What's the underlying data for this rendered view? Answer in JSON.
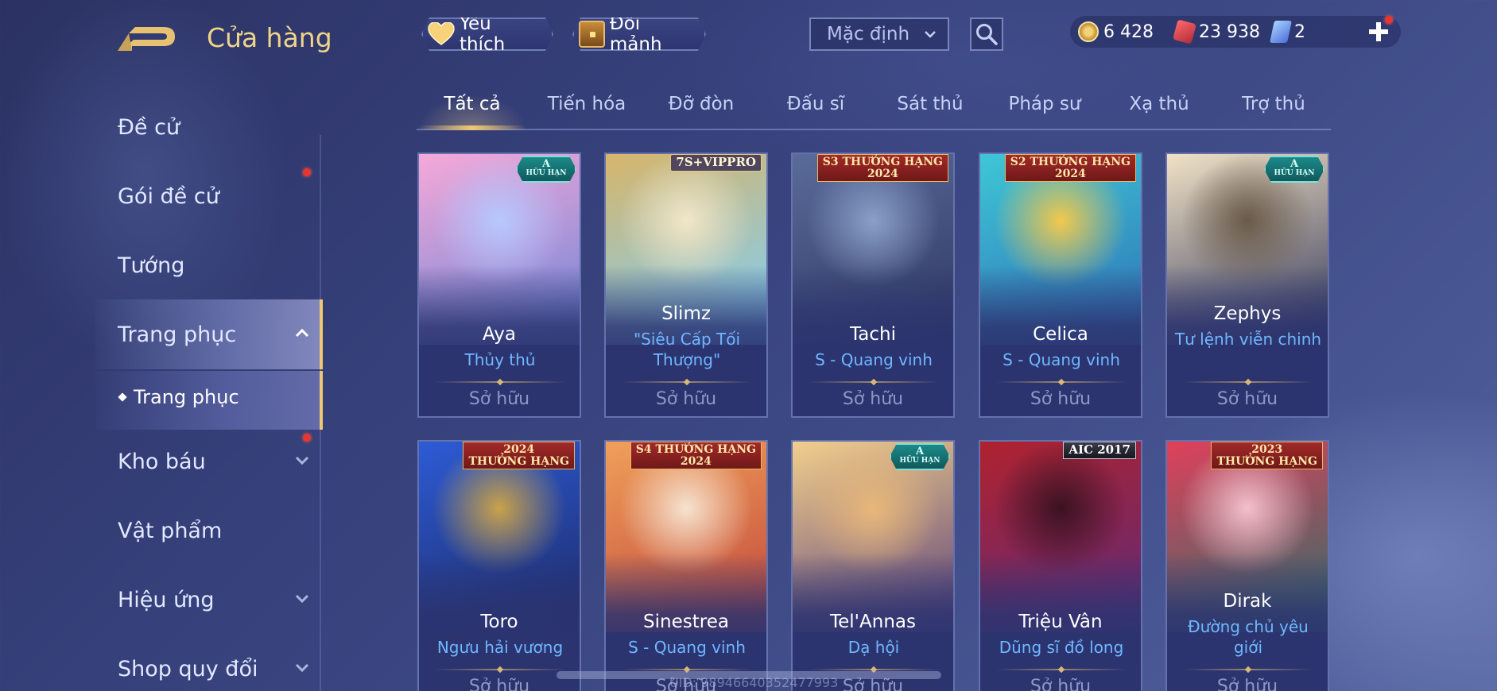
{
  "header": {
    "title": "Cửa hàng",
    "favorite_label": "Yêu thích",
    "shard_exchange_label": "Đổi mảnh",
    "sort_value": "Mặc định"
  },
  "currency": {
    "gold": "6 428",
    "voucher": "23 938",
    "token": "2"
  },
  "sidebar": {
    "items": [
      {
        "label": "Đề cử",
        "icon": "none"
      },
      {
        "label": "Gói đề cử",
        "icon": "none"
      },
      {
        "label": "Tướng",
        "icon": "none"
      },
      {
        "label": "Trang phục",
        "icon": "chevron-up-icon"
      },
      {
        "label": "Kho báu",
        "icon": "chevron-down-icon"
      },
      {
        "label": "Vật phẩm",
        "icon": "none"
      },
      {
        "label": "Hiệu ứng",
        "icon": "chevron-down-icon"
      },
      {
        "label": "Shop quy đổi",
        "icon": "chevron-down-icon"
      }
    ],
    "sub_item": "Trang phục"
  },
  "tabs": [
    "Tất cả",
    "Tiến hóa",
    "Đỡ đòn",
    "Đấu sĩ",
    "Sát thủ",
    "Pháp sư",
    "Xạ thủ",
    "Trợ thủ"
  ],
  "cards": [
    {
      "name": "Aya",
      "skin": "Thủy thủ",
      "status": "Sở hữu",
      "badge_type": "limited",
      "badge_line1": "A",
      "badge_line2": "HỮU HẠN",
      "art": [
        "#f6a9d8",
        "#b7c8ff",
        "#6b83d8"
      ]
    },
    {
      "name": "Slimz",
      "skin": "\"Siêu Cấp Tối Thượng\"",
      "status": "Sở hữu",
      "badge_type": "vip",
      "badge_line1": "7S+VIPPRO",
      "badge_line2": "",
      "art": [
        "#d7b56a",
        "#f2e6c8",
        "#7ad0ff"
      ]
    },
    {
      "name": "Tachi",
      "skin": "S - Quang vinh",
      "status": "Sở hữu",
      "badge_type": "rank",
      "badge_line1": "S3 THƯỞNG HẠNG",
      "badge_line2": "2024",
      "art": [
        "#5a6b9a",
        "#8aa0c8",
        "#2e3660"
      ]
    },
    {
      "name": "Celica",
      "skin": "S - Quang vinh",
      "status": "Sở hữu",
      "badge_type": "rank",
      "badge_line1": "S2 THƯỞNG HẠNG",
      "badge_line2": "2024",
      "art": [
        "#3ec7d6",
        "#f2c94c",
        "#2f6fb5"
      ]
    },
    {
      "name": "Zephys",
      "skin": "Tư lệnh viễn chinh",
      "status": "Sở hữu",
      "badge_type": "limited",
      "badge_line1": "A",
      "badge_line2": "HỮU HẠN",
      "art": [
        "#f1e2c6",
        "#6a5a48",
        "#2f3458"
      ]
    },
    {
      "name": "Toro",
      "skin": "Ngưu hải vương",
      "status": "Sở hữu",
      "badge_type": "rank",
      "badge_line1": "2024",
      "badge_line2": "THƯỞNG HẠNG",
      "art": [
        "#2d5bd6",
        "#c9a24a",
        "#1d2a66"
      ]
    },
    {
      "name": "Sinestrea",
      "skin": "S - Quang vinh",
      "status": "Sở hữu",
      "badge_type": "rank",
      "badge_line1": "S4 THƯỞNG HẠNG",
      "badge_line2": "2024",
      "art": [
        "#f0a05a",
        "#f6e3d0",
        "#c1443a"
      ]
    },
    {
      "name": "Tel'Annas",
      "skin": "Dạ hội",
      "status": "Sở hữu",
      "badge_type": "limited",
      "badge_line1": "A",
      "badge_line2": "HỮU HẠN",
      "art": [
        "#f2cf8c",
        "#e8b77a",
        "#5a3f7a"
      ]
    },
    {
      "name": "Triệu Vân",
      "skin": "Dũng sĩ đồ long",
      "status": "Sở hữu",
      "badge_type": "aic",
      "badge_line1": "AIC 2017",
      "badge_line2": "",
      "art": [
        "#b0222e",
        "#3a1220",
        "#5d2a7a"
      ]
    },
    {
      "name": "Dirak",
      "skin": "Đường chủ yêu giới",
      "status": "Sở hữu",
      "badge_type": "rank",
      "badge_line1": "2023",
      "badge_line2": "THƯỞNG HẠNG",
      "art": [
        "#e0405a",
        "#f4c0cc",
        "#2b6f6a"
      ]
    }
  ],
  "footer": {
    "uid": "UID: 98946640352477993"
  },
  "colors": {
    "accent_gold": "#f0c874",
    "title_gold": "#f0d48a",
    "skin_blue": "#6fb7ff",
    "notification_red": "#e8352f"
  }
}
